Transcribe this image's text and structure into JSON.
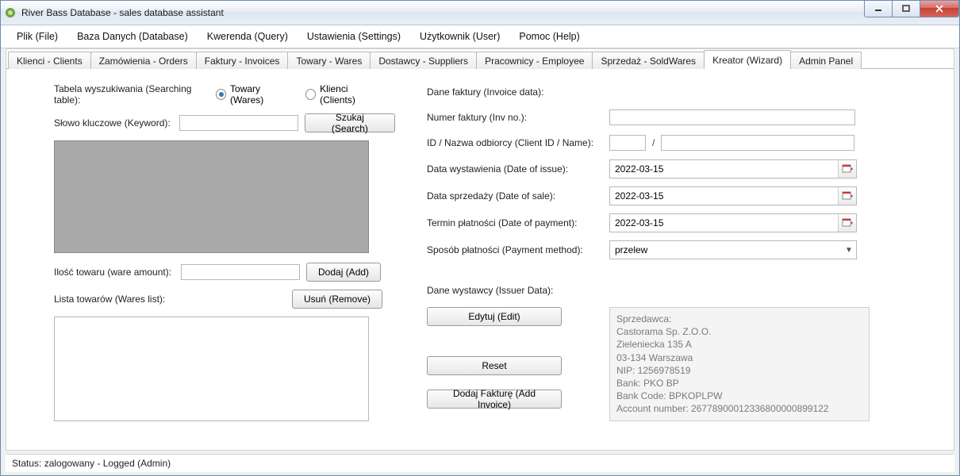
{
  "window": {
    "title": "River Bass Database - sales database assistant"
  },
  "menu": {
    "items": [
      "Plik (File)",
      "Baza Danych (Database)",
      "Kwerenda (Query)",
      "Ustawienia (Settings)",
      "Użytkownik (User)",
      "Pomoc (Help)"
    ]
  },
  "tabs": {
    "items": [
      "Klienci - Clients",
      "Zamówienia - Orders",
      "Faktury - Invoices",
      "Towary - Wares",
      "Dostawcy - Suppliers",
      "Pracownicy - Employee",
      "Sprzedaż - SoldWares",
      "Kreator (Wizard)",
      "Admin Panel"
    ],
    "active": 7
  },
  "left": {
    "search_table_label": "Tabela wyszukiwania (Searching table):",
    "radio_wares": "Towary (Wares)",
    "radio_clients": "Klienci (Clients)",
    "keyword_label": "Słowo kluczowe (Keyword):",
    "keyword_value": "",
    "search_btn": "Szukaj (Search)",
    "ware_amount_label": "Ilość towaru (ware amount):",
    "ware_amount_value": "",
    "add_btn": "Dodaj (Add)",
    "wares_list_label": "Lista towarów (Wares list):",
    "remove_btn": "Usuń (Remove)"
  },
  "right": {
    "invoice_data_label": "Dane faktury (Invoice data):",
    "inv_no_label": "Numer faktury (Inv no.):",
    "inv_no_value": "",
    "client_id_label": "ID / Nazwa odbiorcy (Client ID / Name):",
    "client_id_value": "",
    "client_name_value": "",
    "date_issue_label": "Data wystawienia (Date of issue):",
    "date_issue_value": "2022-03-15",
    "date_sale_label": "Data sprzedaży (Date of sale):",
    "date_sale_value": "2022-03-15",
    "date_pay_label": "Termin płatności (Date of payment):",
    "date_pay_value": "2022-03-15",
    "pay_method_label": "Sposób płatności (Payment method):",
    "pay_method_value": "przelew",
    "issuer_label": "Dane wystawcy (Issuer Data):",
    "edit_btn": "Edytuj (Edit)",
    "reset_btn": "Reset",
    "add_invoice_btn": "Dodaj Fakturę (Add Invoice)",
    "issuer_lines": {
      "l0": "Sprzedawca:",
      "l1": "Castorama Sp. Z.O.O.",
      "l2": "Zieleniecka 135 A",
      "l3": "03-134 Warszawa",
      "l4": "NIP: 1256978519",
      "l5": "Bank: PKO BP",
      "l6": "Bank Code: BPKOPLPW",
      "l7": "Account number: 26778900012336800000899122"
    }
  },
  "status": "Status: zalogowany - Logged (Admin)"
}
